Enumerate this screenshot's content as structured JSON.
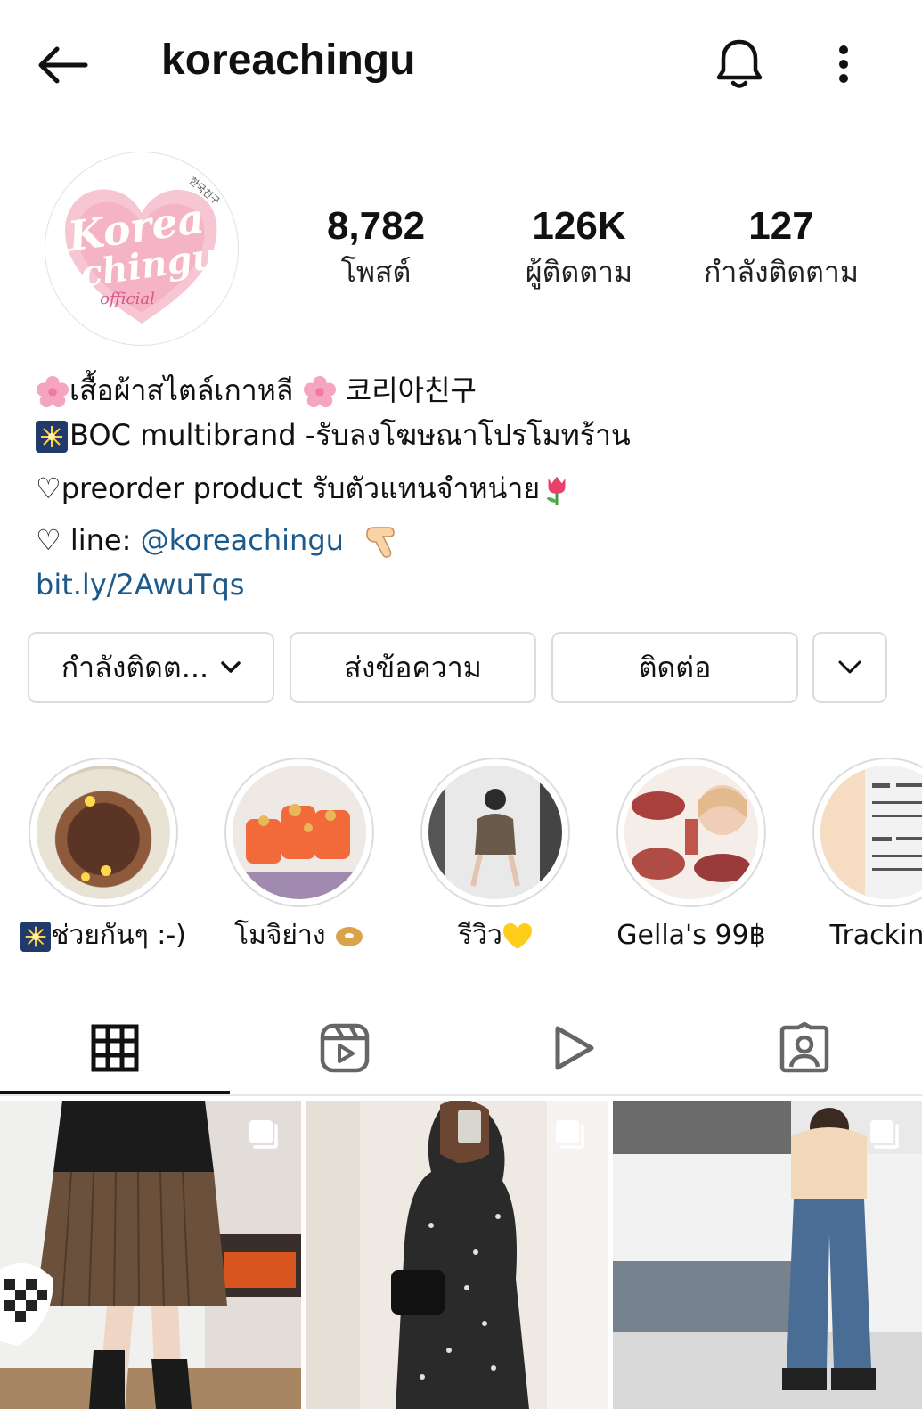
{
  "header": {
    "username": "koreachingu",
    "back_icon": "arrow-left-icon",
    "notify_icon": "bell-icon",
    "more_icon": "more-vertical-icon"
  },
  "avatar": {
    "logo_text_1": "Korea",
    "logo_text_2": "chingu",
    "logo_text_3": "official",
    "logo_text_4": "한국친구"
  },
  "stats": [
    {
      "value": "8,782",
      "label": "โพสต์"
    },
    {
      "value": "126K",
      "label": "ผู้ติดตาม"
    },
    {
      "value": "127",
      "label": "กำลังติดตาม"
    }
  ],
  "bio": {
    "line1_a": "เสื้อผ้าสไตล์เกาหลี ",
    "line1_b": " 코리아친구",
    "line2": "BOC multibrand  -รับลงโฆษณาโปรโมทร้าน",
    "line3": "♡preorder product  รับตัวแทนจำหน่าย",
    "line4_prefix": "♡ line: ",
    "line4_handle": "@koreachingu",
    "link": "bit.ly/2AwuTqs"
  },
  "actions": {
    "following": "กำลังติดต...",
    "message": "ส่งข้อความ",
    "contact": "ติดต่อ"
  },
  "highlights": [
    {
      "label": "ช่วยกันๆ :-)"
    },
    {
      "label": "โมจิย่าง "
    },
    {
      "label": "รีวิว"
    },
    {
      "label": "Gella's 99฿"
    },
    {
      "label": "Tracking"
    }
  ],
  "tabs": [
    {
      "icon": "grid-icon"
    },
    {
      "icon": "reels-icon"
    },
    {
      "icon": "video-play-icon"
    },
    {
      "icon": "tagged-person-icon"
    }
  ],
  "colors": {
    "link": "#1d5a8c",
    "border": "#dbdbdb",
    "text": "#111111"
  }
}
